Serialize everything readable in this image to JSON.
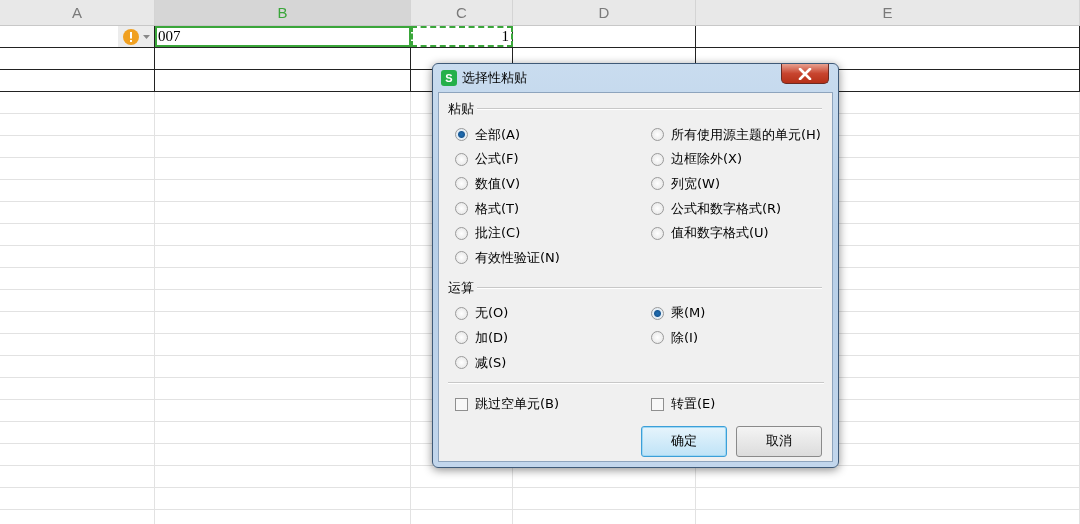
{
  "sheet": {
    "columns": [
      {
        "label": "A",
        "selected": false
      },
      {
        "label": "B",
        "selected": true
      },
      {
        "label": "C",
        "selected": false
      },
      {
        "label": "D",
        "selected": false
      },
      {
        "label": "E",
        "selected": false
      }
    ],
    "active_cell": {
      "value": "007",
      "warning": true
    },
    "copied_cell": {
      "value": "1"
    }
  },
  "dialog": {
    "title": "选择性粘贴",
    "app_icon": "S",
    "sections": [
      {
        "title": "粘贴",
        "options": [
          {
            "label": "全部(A)",
            "selected": true
          },
          {
            "label": "所有使用源主题的单元(H)",
            "selected": false
          },
          {
            "label": "公式(F)",
            "selected": false
          },
          {
            "label": "边框除外(X)",
            "selected": false
          },
          {
            "label": "数值(V)",
            "selected": false
          },
          {
            "label": "列宽(W)",
            "selected": false
          },
          {
            "label": "格式(T)",
            "selected": false
          },
          {
            "label": "公式和数字格式(R)",
            "selected": false
          },
          {
            "label": "批注(C)",
            "selected": false
          },
          {
            "label": "值和数字格式(U)",
            "selected": false
          },
          {
            "label": "有效性验证(N)",
            "selected": false
          }
        ]
      },
      {
        "title": "运算",
        "options": [
          {
            "label": "无(O)",
            "selected": false
          },
          {
            "label": "乘(M)",
            "selected": true
          },
          {
            "label": "加(D)",
            "selected": false
          },
          {
            "label": "除(I)",
            "selected": false
          },
          {
            "label": "减(S)",
            "selected": false
          }
        ]
      }
    ],
    "checkboxes": [
      {
        "label": "跳过空单元(B)",
        "checked": false
      },
      {
        "label": "转置(E)",
        "checked": false
      }
    ],
    "buttons": [
      {
        "label": "确定",
        "default": true
      },
      {
        "label": "取消",
        "default": false
      }
    ]
  }
}
